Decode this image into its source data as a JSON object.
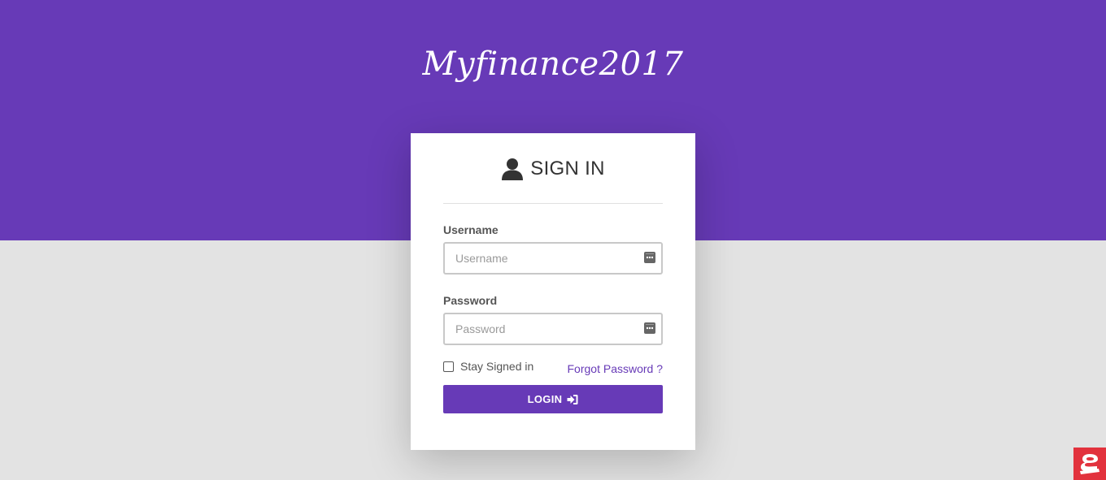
{
  "brand": {
    "logo_text": "Myfinance2017"
  },
  "login_card": {
    "title": "SIGN IN",
    "title_icon": "user-icon",
    "username": {
      "label": "Username",
      "placeholder": "Username",
      "value": ""
    },
    "password": {
      "label": "Password",
      "placeholder": "Password",
      "value": ""
    },
    "remember_label": "Stay Signed in",
    "remember_checked": false,
    "forgot_link": "Forgot Password ?",
    "login_button": "LOGIN",
    "login_button_icon": "sign-in-icon"
  },
  "colors": {
    "primary": "#673ab7",
    "background": "#e3e3e3",
    "card": "#ffffff",
    "badge": "#e2323d"
  },
  "corner_badge_icon": "app-badge-icon"
}
